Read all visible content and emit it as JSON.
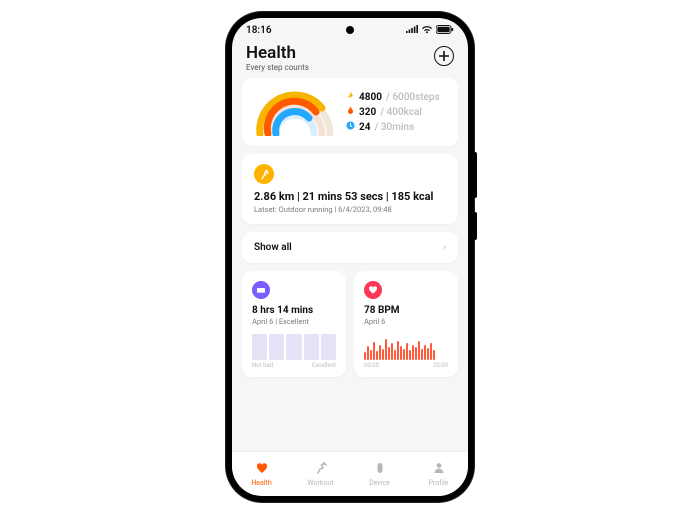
{
  "status": {
    "time": "18:16"
  },
  "header": {
    "title": "Health",
    "subtitle": "Every step counts"
  },
  "goals": {
    "steps": {
      "value": "4800",
      "goal": "6000",
      "unit": "steps",
      "color": "#f7b500"
    },
    "calories": {
      "value": "320",
      "goal": "400",
      "unit": "kcal",
      "color": "#ff5a00"
    },
    "stand": {
      "value": "24",
      "goal": "30",
      "unit": "mins",
      "color": "#23a7ff"
    }
  },
  "workout_card": {
    "title": "2.86 km | 21 mins 53 secs | 185 kcal",
    "subtitle": "Latset:  Outdoor running | 6/4/2023, 09:48"
  },
  "show_all": {
    "label": "Show all"
  },
  "sleep_card": {
    "title": "8 hrs 14 mins",
    "subtitle": "April 6 | Excellent",
    "lab_left": "Not bad",
    "lab_right": "Excellent",
    "icon_color": "#7a5cff"
  },
  "hr_card": {
    "title": "78 BPM",
    "subtitle": "April 6",
    "lab_left": "00:00",
    "lab_right": "20:00",
    "icon_color": "#ff3756"
  },
  "nav": {
    "items": [
      {
        "label": "Health"
      },
      {
        "label": "Workout"
      },
      {
        "label": "Device"
      },
      {
        "label": "Profile"
      }
    ]
  }
}
